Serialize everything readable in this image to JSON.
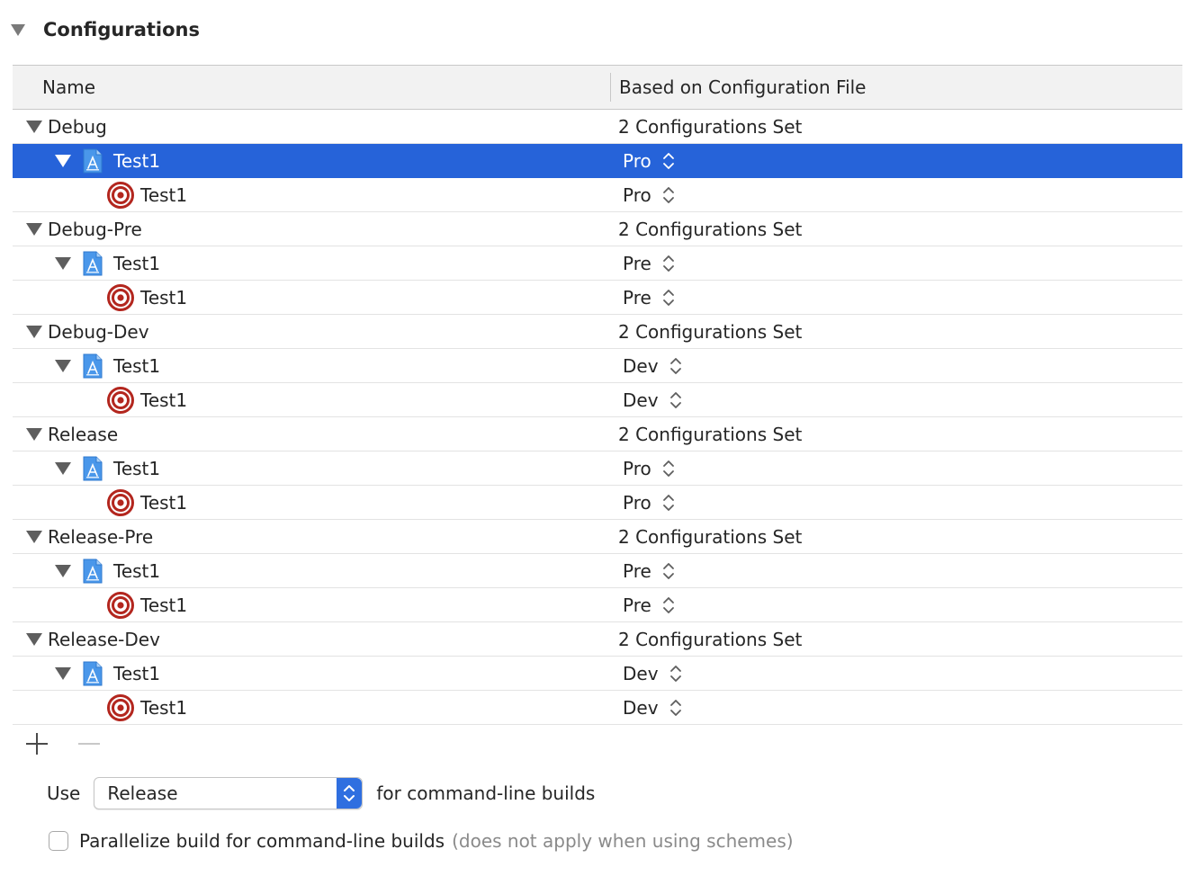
{
  "section": {
    "title": "Configurations"
  },
  "table": {
    "columns": {
      "name": "Name",
      "file": "Based on Configuration File"
    },
    "groups": [
      {
        "name": "Debug",
        "summary": "2 Configurations Set",
        "project": {
          "name": "Test1",
          "file": "Pro",
          "selected": true
        },
        "target": {
          "name": "Test1",
          "file": "Pro"
        }
      },
      {
        "name": "Debug-Pre",
        "summary": "2 Configurations Set",
        "project": {
          "name": "Test1",
          "file": "Pre"
        },
        "target": {
          "name": "Test1",
          "file": "Pre"
        }
      },
      {
        "name": "Debug-Dev",
        "summary": "2 Configurations Set",
        "project": {
          "name": "Test1",
          "file": "Dev"
        },
        "target": {
          "name": "Test1",
          "file": "Dev"
        }
      },
      {
        "name": "Release",
        "summary": "2 Configurations Set",
        "project": {
          "name": "Test1",
          "file": "Pro"
        },
        "target": {
          "name": "Test1",
          "file": "Pro"
        }
      },
      {
        "name": "Release-Pre",
        "summary": "2 Configurations Set",
        "project": {
          "name": "Test1",
          "file": "Pre"
        },
        "target": {
          "name": "Test1",
          "file": "Pre"
        }
      },
      {
        "name": "Release-Dev",
        "summary": "2 Configurations Set",
        "project": {
          "name": "Test1",
          "file": "Dev"
        },
        "target": {
          "name": "Test1",
          "file": "Dev"
        }
      }
    ]
  },
  "footer": {
    "use_label": "Use",
    "use_value": "Release",
    "use_suffix": "for command-line builds",
    "parallel_label": "Parallelize build for command-line builds",
    "parallel_note": "(does not apply when using schemes)",
    "parallel_checked": false
  },
  "colors": {
    "selection": "#2663d9",
    "target_red": "#b3261e",
    "project_blue": "#3d8be6"
  },
  "icons": {
    "disclosure": "disclosure-triangle-icon",
    "project": "xcode-project-icon",
    "target": "target-icon",
    "popup": "up-down-chevron-icon",
    "add": "plus-icon",
    "remove": "minus-icon"
  }
}
